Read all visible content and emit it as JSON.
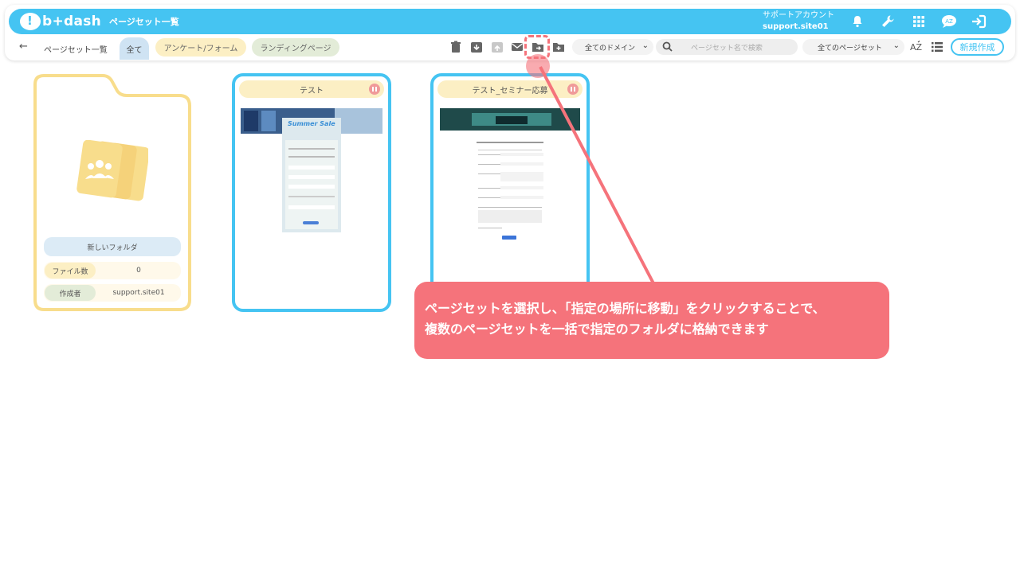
{
  "app": {
    "logo_text": "b+dash",
    "page_title": "ページセット一覧",
    "account_label": "サポートアカウント",
    "account_name": "support.site01"
  },
  "toolbar": {
    "breadcrumb": "ページセット一覧",
    "tabs": [
      "全て",
      "アンケート/フォーム",
      "ランディングページ"
    ],
    "domain_select": "全てのドメイン",
    "search_placeholder": "ページセット名で検索",
    "pageset_select": "全てのページセット",
    "new_button": "新規作成"
  },
  "folder": {
    "name": "新しいフォルダ",
    "file_count_label": "ファイル数",
    "file_count": "0",
    "creator_label": "作成者",
    "creator": "support.site01"
  },
  "cards": [
    {
      "title": "テスト",
      "thumbnail_heading": "Summer Sale"
    },
    {
      "title": "テスト_セミナー応募"
    }
  ],
  "callout": {
    "line1": "ページセットを選択し、「指定の場所に移動」をクリックすることで、",
    "line2": "複数のページセットを一括で指定のフォルダに格納できます"
  },
  "colors": {
    "accent": "#45c4f2",
    "callout": "#f5737b",
    "folder": "#f8dd8c"
  }
}
